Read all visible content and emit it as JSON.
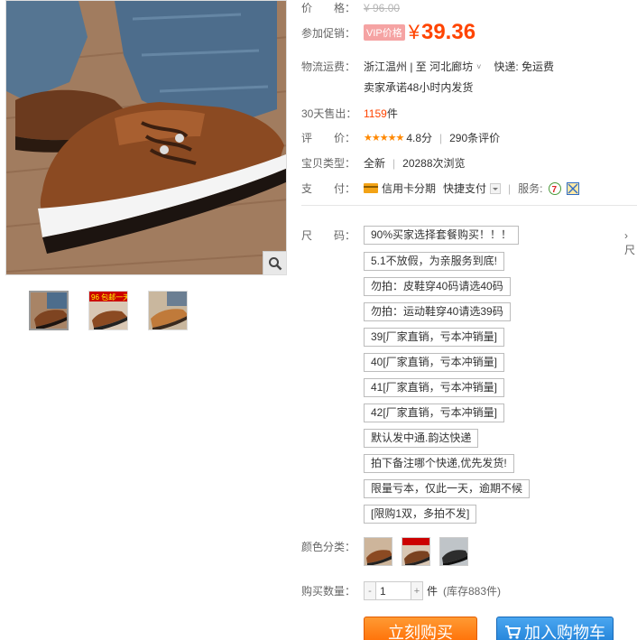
{
  "price": {
    "label": "价　　格：",
    "original": "¥ 96.00"
  },
  "promo": {
    "label": "参加促销：",
    "badge": "VIP价格",
    "yen": "¥",
    "price": "39.36"
  },
  "shipping": {
    "label": "物流运费：",
    "route": "浙江温州 | 至  河北廊坊",
    "courier": "快递: 免运费",
    "note": "卖家承诺48小时内发货"
  },
  "sales": {
    "label": "30天售出：",
    "count": "1159",
    "unit": "件"
  },
  "rating": {
    "label": "评　　价：",
    "stars": "★★★★★",
    "score": "4.8分",
    "reviews": "290条评价"
  },
  "item_type": {
    "label": "宝贝类型：",
    "condition": "全新",
    "views": "20288次浏览"
  },
  "payment": {
    "label": "支　　付：",
    "installment": "信用卡分期",
    "quick": "快捷支付",
    "service_label": "服务:"
  },
  "size": {
    "label": "尺　　码：",
    "more": "› 尺",
    "options": [
      "90%买家选择套餐购买！！！",
      "5.1不放假，为亲服务到底!",
      "勿拍：皮鞋穿40码请选40码",
      "勿拍：运动鞋穿40请选39码",
      "39[厂家直销，亏本冲销量]",
      "40[厂家直销，亏本冲销量]",
      "41[厂家直销，亏本冲销量]",
      "42[厂家直销，亏本冲销量]",
      "默认发中通.韵达快递",
      "拍下备注哪个快递,优先发货!",
      "限量亏本，仅此一天，逾期不候",
      "[限购1双，多拍不发]"
    ]
  },
  "color": {
    "label": "颜色分类："
  },
  "quantity": {
    "label": "购买数量：",
    "minus": "-",
    "value": "1",
    "plus": "+",
    "unit": "件",
    "stock": "(库存883件)"
  },
  "actions": {
    "buy": "立刻购买",
    "cart": "加入购物车"
  },
  "gallery": {
    "thumb2_text": "96 包邮一天"
  },
  "colors": {
    "accent": "#ff4400",
    "buy": "#ff6a00",
    "cart": "#1e7fd6"
  }
}
